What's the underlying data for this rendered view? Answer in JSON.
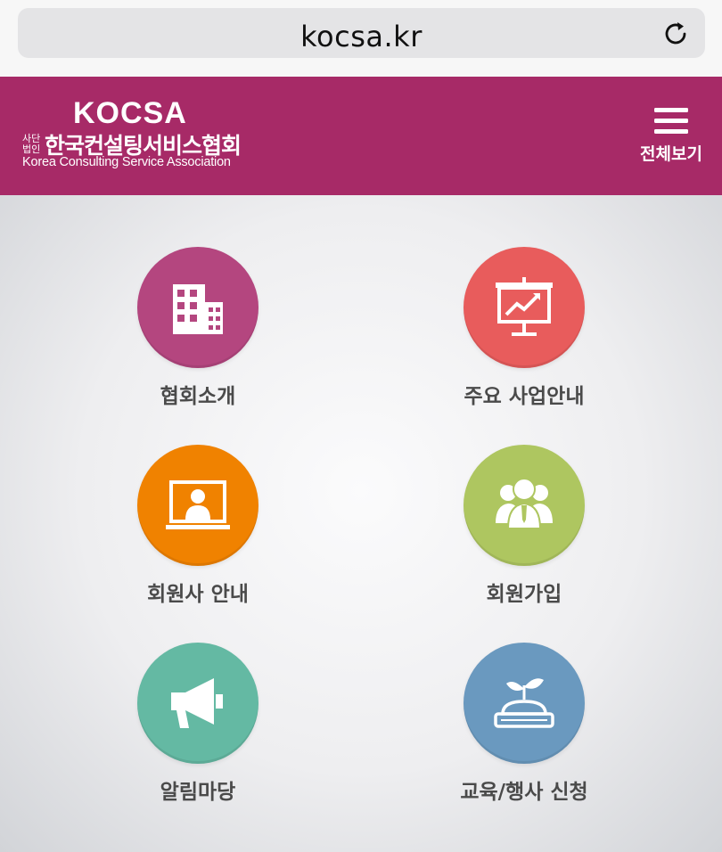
{
  "browser": {
    "url": "kocsa.kr",
    "reload_icon": "reload-icon"
  },
  "header": {
    "logo_mark": "KOCSA",
    "logo_prefix": "사단법인",
    "logo_korean": "한국컨설팅서비스협회",
    "logo_english": "Korea Consulting Service Association",
    "menu_label": "전체보기",
    "menu_icon": "hamburger-icon",
    "background_color": "#a72a67"
  },
  "tiles": [
    {
      "label": "협회소개",
      "icon": "building-icon",
      "color": "#b4467f"
    },
    {
      "label": "주요 사업안내",
      "icon": "presentation-icon",
      "color": "#e85c5c"
    },
    {
      "label": "회원사 안내",
      "icon": "monitor-user-icon",
      "color": "#f08200"
    },
    {
      "label": "회원가입",
      "icon": "people-icon",
      "color": "#aec660"
    },
    {
      "label": "알림마당",
      "icon": "megaphone-icon",
      "color": "#64b9a3"
    },
    {
      "label": "교육/행사 신청",
      "icon": "book-sprout-icon",
      "color": "#6a99bf"
    }
  ]
}
